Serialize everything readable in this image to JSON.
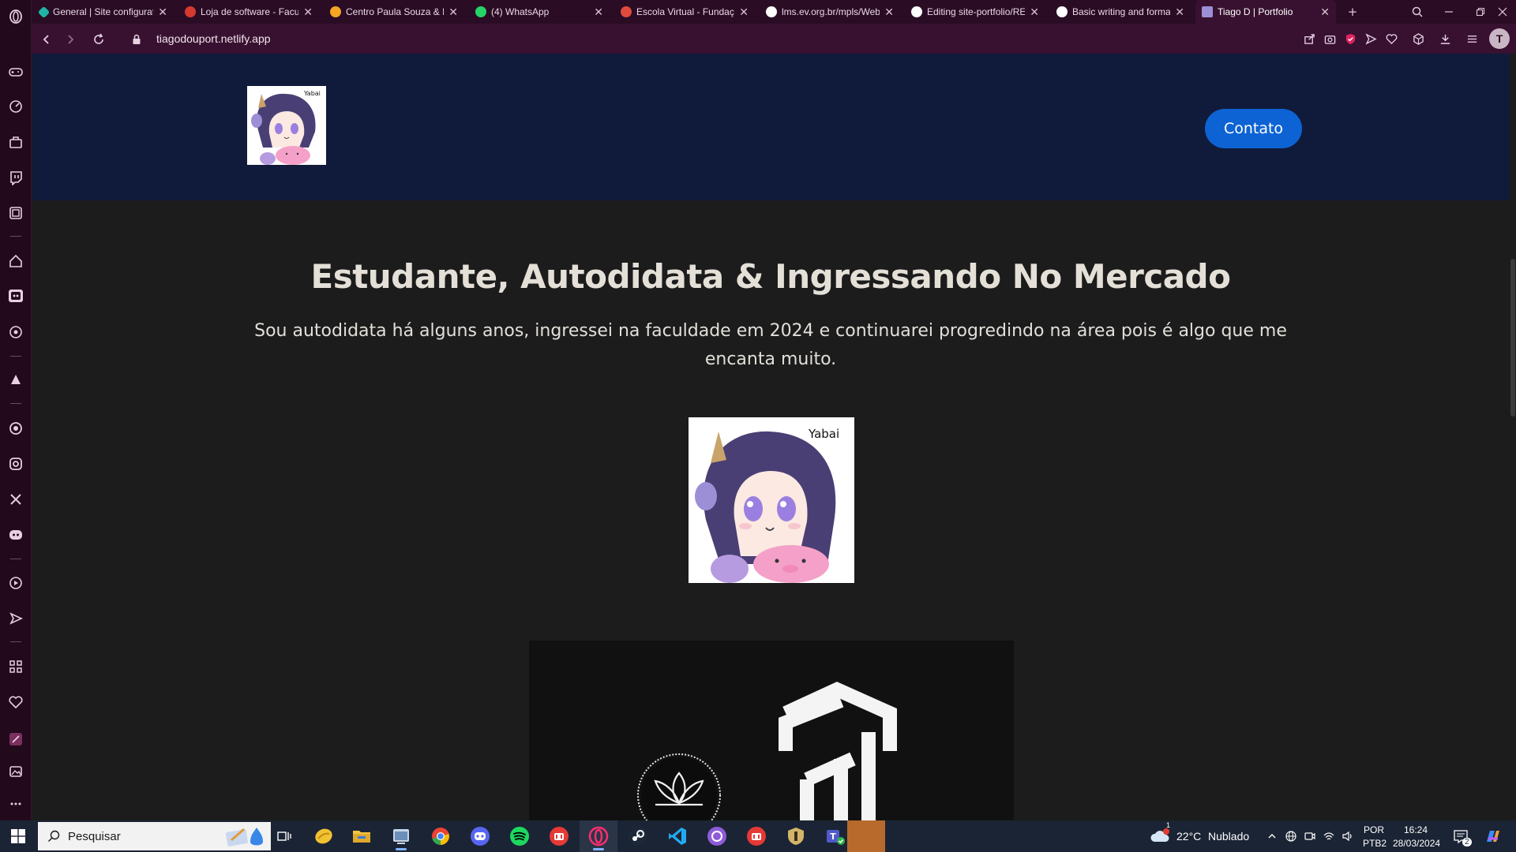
{
  "browser": {
    "tabs": [
      {
        "title": "General | Site configurat",
        "favicon_color": "#1fb5a6"
      },
      {
        "title": "Loja de software - Facul",
        "favicon_color": "#d63a2f"
      },
      {
        "title": "Centro Paula Souza & M",
        "favicon_color": "#f5a623"
      },
      {
        "title": "(4) WhatsApp",
        "favicon_color": "#25d366"
      },
      {
        "title": "Escola Virtual - Fundaçã",
        "favicon_color": "#e14b3b"
      },
      {
        "title": "lms.ev.org.br/mpls/Web",
        "favicon_color": "#ffffff"
      },
      {
        "title": "Editing site-portfolio/RE",
        "favicon_color": "#ffffff"
      },
      {
        "title": "Basic writing and format",
        "favicon_color": "#ffffff"
      },
      {
        "title": "Tiago D | Portfolio",
        "favicon_color": "#9c8fd6"
      }
    ],
    "url": "tiagodouport.netlify.app",
    "profile_initial": "T"
  },
  "site": {
    "contact_label": "Contato",
    "hero_title": "Estudante, Autodidata & Ingressando No Mercado",
    "hero_description": "Sou autodidata há alguns anos, ingressei na faculdade em 2024 e continuarei progredindo na área pois é algo que me encanta muito.",
    "avatar_caption": "Yabai"
  },
  "taskbar": {
    "search_placeholder": "Pesquisar",
    "weather_temp": "22°C",
    "weather_desc": "Nublado",
    "weather_badge": "1",
    "language": "POR",
    "keyboard": "PTB2",
    "time": "16:24",
    "date": "28/03/2024",
    "notifications_count": "2"
  },
  "colors": {
    "sidebar": "#220a1c",
    "tab_bar": "#2a0c24",
    "address_bar": "#381131",
    "site_header": "#101a3a",
    "page_bg": "#1c1c1c",
    "contact_button": "#0d63d3",
    "taskbar": "#1b2434"
  }
}
